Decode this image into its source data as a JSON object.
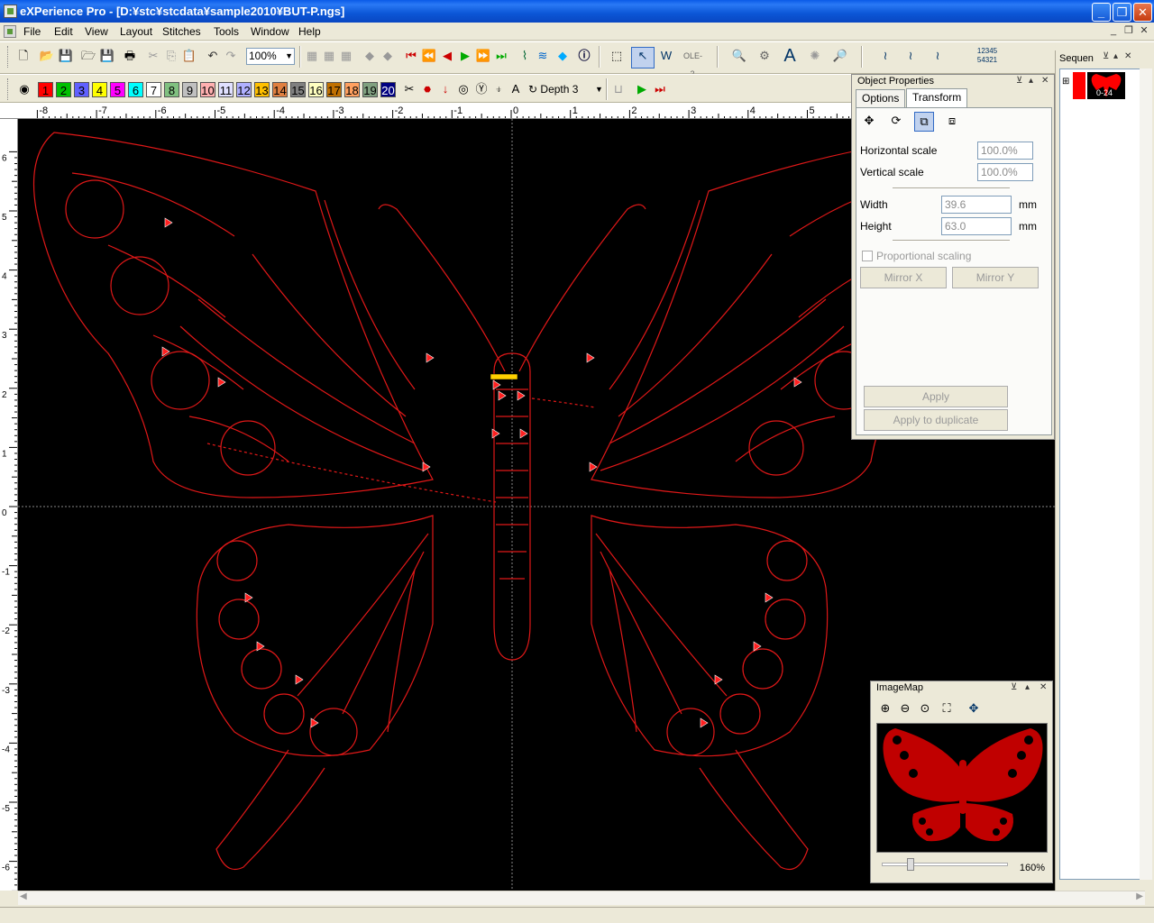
{
  "window": {
    "title": "eXPerience Pro - [D:¥stc¥stcdata¥sample2010¥BUT-P.ngs]"
  },
  "menu": [
    "File",
    "Edit",
    "View",
    "Layout",
    "Stitches",
    "Tools",
    "Window",
    "Help"
  ],
  "toolbar": {
    "zoom_value": "100%",
    "depth_label": "Depth 3",
    "ole_label": "OLE-2",
    "seq_numbers_top": "12345",
    "seq_numbers_bottom": "54321"
  },
  "colors": {
    "chips": [
      {
        "n": "1",
        "bg": "#ff0000"
      },
      {
        "n": "2",
        "bg": "#00c000"
      },
      {
        "n": "3",
        "bg": "#6060ff"
      },
      {
        "n": "4",
        "bg": "#ffff00"
      },
      {
        "n": "5",
        "bg": "#ff00ff"
      },
      {
        "n": "6",
        "bg": "#00ffff"
      },
      {
        "n": "7",
        "bg": "#ffffff"
      },
      {
        "n": "8",
        "bg": "#80c080"
      },
      {
        "n": "9",
        "bg": "#c0c0c0"
      },
      {
        "n": "10",
        "bg": "#ffb0b0"
      },
      {
        "n": "11",
        "bg": "#e0e0ff"
      },
      {
        "n": "12",
        "bg": "#b0b0ff"
      },
      {
        "n": "13",
        "bg": "#ffc000"
      },
      {
        "n": "14",
        "bg": "#e08040"
      },
      {
        "n": "15",
        "bg": "#808080"
      },
      {
        "n": "16",
        "bg": "#ffffc0"
      },
      {
        "n": "17",
        "bg": "#c07000"
      },
      {
        "n": "18",
        "bg": "#ffa060"
      },
      {
        "n": "19",
        "bg": "#80a080"
      },
      {
        "n": "20",
        "bg": "#000080"
      }
    ],
    "design_color": "#ff0000",
    "canvas_bg": "#000000"
  },
  "rulers": {
    "top": [
      "-8",
      "-7",
      "-6",
      "-5",
      "-4",
      "-3",
      "-2",
      "-1",
      "0",
      "1",
      "2",
      "3",
      "4",
      "5"
    ],
    "left": [
      "6",
      "5",
      "4",
      "3",
      "2",
      "1",
      "0",
      "-1",
      "-2",
      "-3",
      "-4",
      "-5",
      "-6"
    ]
  },
  "object_properties": {
    "title": "Object Properties",
    "tabs": [
      "Options",
      "Transform"
    ],
    "active_tab": "Transform",
    "horizontal_scale_label": "Horizontal scale",
    "horizontal_scale_value": "100.0%",
    "vertical_scale_label": "Vertical scale",
    "vertical_scale_value": "100.0%",
    "width_label": "Width",
    "width_value": "39.6",
    "width_unit": "mm",
    "height_label": "Height",
    "height_value": "63.0",
    "height_unit": "mm",
    "proportional_label": "Proportional scaling",
    "mirror_x": "Mirror X",
    "mirror_y": "Mirror Y",
    "apply": "Apply",
    "apply_dup": "Apply to duplicate"
  },
  "sequence": {
    "title": "Sequen",
    "item_label": "0-24"
  },
  "imagemap": {
    "title": "ImageMap",
    "zoom": "160%"
  }
}
